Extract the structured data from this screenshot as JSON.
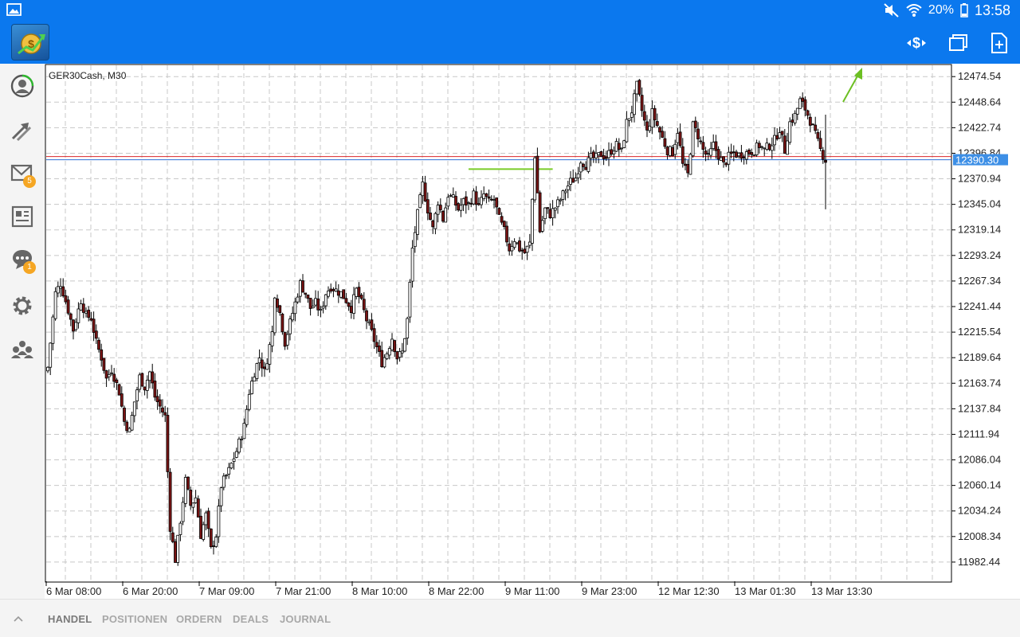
{
  "status": {
    "battery": "20%",
    "time": "13:58"
  },
  "chart": {
    "symbol_label": "GER30Cash, M30",
    "current_price_label": "12390.30"
  },
  "chart_data": {
    "type": "candlestick",
    "symbol": "GER30Cash",
    "timeframe": "M30",
    "price_ticks": [
      12474.54,
      12448.64,
      12422.74,
      12396.84,
      12370.94,
      12345.04,
      12319.14,
      12293.24,
      12267.34,
      12241.44,
      12215.54,
      12189.64,
      12163.74,
      12137.84,
      12111.94,
      12086.04,
      12060.14,
      12034.24,
      12008.34,
      11982.44
    ],
    "time_ticks": [
      "6 Mar 08:00",
      "6 Mar 20:00",
      "7 Mar 09:00",
      "7 Mar 21:00",
      "8 Mar 10:00",
      "8 Mar 22:00",
      "9 Mar 11:00",
      "9 Mar 23:00",
      "12 Mar 12:30",
      "13 Mar 01:30",
      "13 Mar 13:30"
    ],
    "ylim": [
      11963,
      12486
    ],
    "current_price": 12390.3,
    "lines": [
      {
        "name": "bid",
        "price": 12393.5,
        "color": "#d9252a"
      },
      {
        "name": "ask",
        "price": 12390.3,
        "color": "#2f6fd6"
      },
      {
        "name": "support",
        "price": 12380.8,
        "color": "#7acc29",
        "from_index": 165,
        "to_index": 198
      }
    ],
    "colors": {
      "bull": "#ffffff",
      "bear": "#7a1414",
      "wick": "#000000",
      "grid": "#c8c8c8"
    },
    "close_path": [
      [
        0,
        12180
      ],
      [
        3,
        12255
      ],
      [
        5,
        12265
      ],
      [
        8,
        12238
      ],
      [
        10,
        12218
      ],
      [
        13,
        12248
      ],
      [
        15,
        12232
      ],
      [
        17,
        12230
      ],
      [
        19,
        12205
      ],
      [
        21,
        12190
      ],
      [
        23,
        12168
      ],
      [
        25,
        12178
      ],
      [
        28,
        12155
      ],
      [
        30,
        12125
      ],
      [
        32,
        12115
      ],
      [
        34,
        12145
      ],
      [
        36,
        12170
      ],
      [
        38,
        12160
      ],
      [
        40,
        12175
      ],
      [
        42,
        12150
      ],
      [
        44,
        12140
      ],
      [
        46,
        12130
      ],
      [
        48,
        12018
      ],
      [
        50,
        11985
      ],
      [
        52,
        12025
      ],
      [
        54,
        12065
      ],
      [
        56,
        12040
      ],
      [
        58,
        12048
      ],
      [
        60,
        12010
      ],
      [
        62,
        12030
      ],
      [
        64,
        11995
      ],
      [
        66,
        12010
      ],
      [
        68,
        12060
      ],
      [
        71,
        12075
      ],
      [
        74,
        12095
      ],
      [
        77,
        12120
      ],
      [
        79,
        12155
      ],
      [
        81,
        12175
      ],
      [
        83,
        12190
      ],
      [
        85,
        12175
      ],
      [
        88,
        12215
      ],
      [
        89,
        12255
      ],
      [
        91,
        12235
      ],
      [
        93,
        12205
      ],
      [
        95,
        12225
      ],
      [
        97,
        12245
      ],
      [
        99,
        12265
      ],
      [
        101,
        12255
      ],
      [
        103,
        12240
      ],
      [
        105,
        12245
      ],
      [
        107,
        12235
      ],
      [
        109,
        12255
      ],
      [
        111,
        12262
      ],
      [
        113,
        12258
      ],
      [
        115,
        12255
      ],
      [
        117,
        12248
      ],
      [
        119,
        12240
      ],
      [
        121,
        12258
      ],
      [
        123,
        12245
      ],
      [
        125,
        12228
      ],
      [
        127,
        12215
      ],
      [
        129,
        12200
      ],
      [
        131,
        12185
      ],
      [
        133,
        12195
      ],
      [
        135,
        12210
      ],
      [
        137,
        12190
      ],
      [
        139,
        12195
      ],
      [
        141,
        12228
      ],
      [
        143,
        12300
      ],
      [
        145,
        12335
      ],
      [
        147,
        12365
      ],
      [
        149,
        12340
      ],
      [
        151,
        12320
      ],
      [
        153,
        12348
      ],
      [
        155,
        12330
      ],
      [
        157,
        12355
      ],
      [
        159,
        12350
      ],
      [
        161,
        12340
      ],
      [
        163,
        12348
      ],
      [
        165,
        12345
      ],
      [
        167,
        12355
      ],
      [
        169,
        12342
      ],
      [
        171,
        12355
      ],
      [
        173,
        12347
      ],
      [
        175,
        12350
      ],
      [
        177,
        12330
      ],
      [
        179,
        12318
      ],
      [
        181,
        12300
      ],
      [
        183,
        12310
      ],
      [
        185,
        12300
      ],
      [
        187,
        12296
      ],
      [
        189,
        12305
      ],
      [
        191,
        12395
      ],
      [
        193,
        12318
      ],
      [
        195,
        12340
      ],
      [
        197,
        12335
      ],
      [
        199,
        12342
      ],
      [
        201,
        12350
      ],
      [
        203,
        12360
      ],
      [
        205,
        12368
      ],
      [
        207,
        12372
      ],
      [
        209,
        12390
      ],
      [
        211,
        12385
      ],
      [
        213,
        12392
      ],
      [
        215,
        12392
      ],
      [
        217,
        12396
      ],
      [
        219,
        12393
      ],
      [
        221,
        12400
      ],
      [
        223,
        12405
      ],
      [
        225,
        12398
      ],
      [
        227,
        12428
      ],
      [
        229,
        12440
      ],
      [
        231,
        12465
      ],
      [
        233,
        12440
      ],
      [
        235,
        12418
      ],
      [
        237,
        12438
      ],
      [
        239,
        12425
      ],
      [
        241,
        12412
      ],
      [
        243,
        12400
      ],
      [
        245,
        12398
      ],
      [
        247,
        12420
      ],
      [
        249,
        12385
      ],
      [
        251,
        12375
      ],
      [
        253,
        12425
      ],
      [
        255,
        12415
      ],
      [
        257,
        12400
      ],
      [
        259,
        12392
      ],
      [
        261,
        12405
      ],
      [
        263,
        12395
      ],
      [
        265,
        12385
      ],
      [
        267,
        12393
      ],
      [
        269,
        12397
      ],
      [
        271,
        12395
      ],
      [
        273,
        12397
      ],
      [
        275,
        12398
      ],
      [
        277,
        12400
      ],
      [
        279,
        12405
      ],
      [
        281,
        12400
      ],
      [
        283,
        12405
      ],
      [
        285,
        12410
      ],
      [
        287,
        12422
      ],
      [
        289,
        12400
      ],
      [
        291,
        12428
      ],
      [
        293,
        12435
      ],
      [
        295,
        12450
      ],
      [
        297,
        12442
      ],
      [
        299,
        12430
      ],
      [
        301,
        12415
      ],
      [
        303,
        12400
      ],
      [
        305,
        12390
      ]
    ]
  },
  "tabs": [
    {
      "label": "HANDEL"
    },
    {
      "label": "POSITIONEN"
    },
    {
      "label": "ORDERN"
    },
    {
      "label": "DEALS"
    },
    {
      "label": "JOURNAL"
    }
  ],
  "badges": {
    "mail": "5",
    "chat": "1"
  }
}
